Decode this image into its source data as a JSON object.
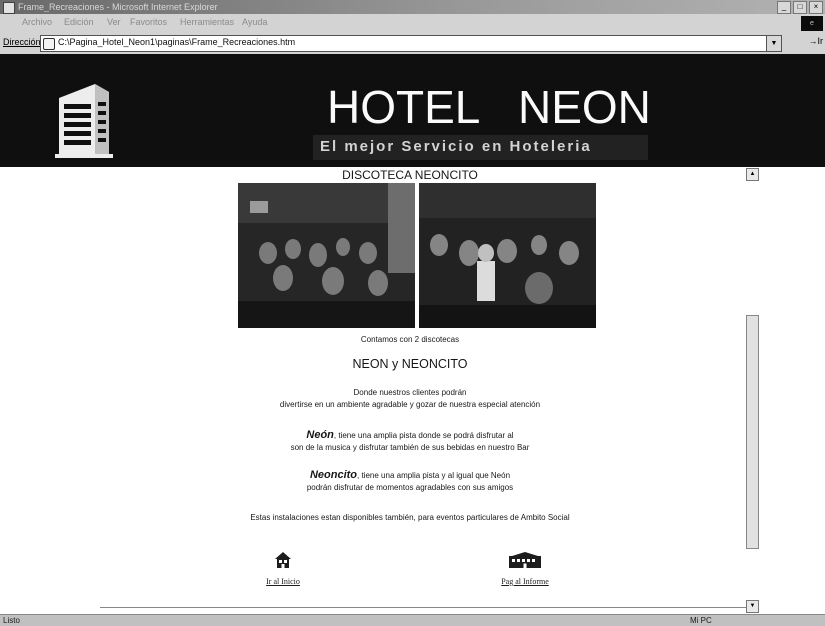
{
  "window": {
    "title": "Frame_Recreaciones - Microsoft Internet Explorer",
    "controls": [
      "_",
      "□",
      "×"
    ]
  },
  "menubar": {
    "items": [
      "Archivo",
      "Edición",
      "Ver",
      "Favoritos",
      "Herramientas",
      "Ayuda"
    ]
  },
  "addressbar": {
    "label": "Dirección",
    "value": "C:\\Pagina_Hotel_Neon1\\paginas\\Frame_Recreaciones.htm",
    "go_label": "Ir"
  },
  "banner": {
    "title_word1": "HOTEL",
    "title_word2": "NEON",
    "slogan": "El mejor Servicio en Hoteleria"
  },
  "page": {
    "section_title": "DISCOTECA NEONCITO",
    "caption": "Contamos con 2 discotecas",
    "subtitle": "NEON y NEONCITO",
    "intro_line1": "Donde nuestros clientes podrán",
    "intro_line2": "divertirse en un ambiente agradable y gozar de nuestra especial atención",
    "neon_name": "Neón",
    "neon_line1": ", tiene una amplia pista donde se podrá disfrutar al",
    "neon_line2": "son de la musica y disfrutar también de sus bebidas en nuestro Bar",
    "neoncito_name": "Neoncito",
    "neoncito_line1": ", tiene una amplia pista y al igual que Neón",
    "neoncito_line2": "podrán disfrutar de momentos agradables con sus amigos",
    "events_text": "Estas instalaciones estan disponibles también, para eventos particulares de Ambito Social",
    "nav_home": "Ir al Inicio",
    "nav_bottom": "Pag al Informe"
  },
  "statusbar": {
    "text": "Listo",
    "zone": "Mi PC"
  },
  "icons": {
    "window": "ie-page-icon",
    "logo": "hotel-building-logo",
    "home": "house-icon",
    "bottom": "building-icon"
  }
}
